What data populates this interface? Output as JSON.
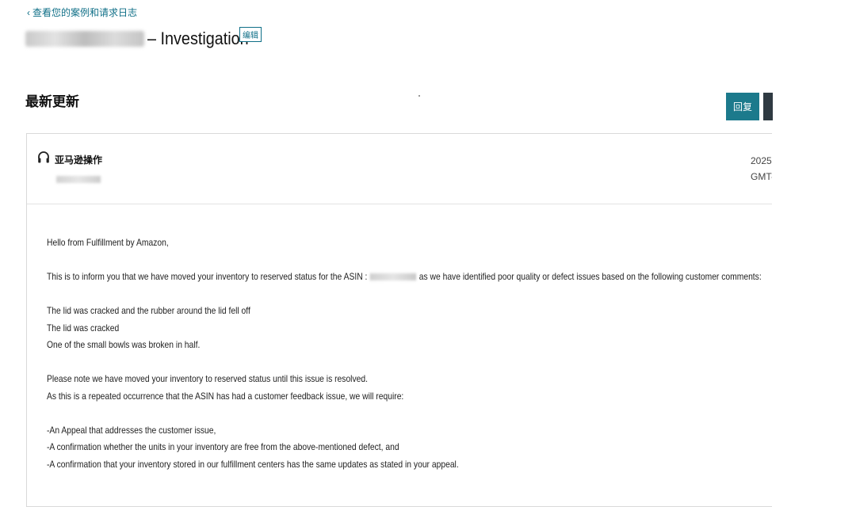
{
  "nav": {
    "back_chevron": "‹",
    "back_label": "查看您的案例和请求日志"
  },
  "header": {
    "title_suffix": "– Investigation",
    "edit_label": "编辑"
  },
  "section": {
    "title": "最新更新"
  },
  "actions": {
    "reply_label": "回复"
  },
  "message": {
    "icon": "headset-icon",
    "sender": "亚马逊操作",
    "date_line1": "2025",
    "date_line2": "GMT-",
    "greeting": "Hello from Fulfillment by Amazon,",
    "inform_prefix": "This is to inform you that we have moved your inventory to reserved status for the ASIN :",
    "inform_suffix": "as we have identified poor quality or defect issues based on the following customer comments:",
    "comment1": "The lid was cracked and the rubber around the lid fell off",
    "comment2": "The lid was cracked",
    "comment3": "One of the small bowls was broken in half.",
    "note1": "Please note we have moved your inventory to reserved status until this issue is resolved.",
    "note2": "As this is a repeated occurrence that the ASIN has had a customer feedback issue, we will require:",
    "req1": "-An Appeal that addresses the customer issue,",
    "req2": "-A confirmation whether the units in your inventory are free from the above-mentioned defect, and",
    "req3": "-A confirmation that your inventory stored in our fulfillment centers has the same updates as stated in your appeal."
  },
  "colors": {
    "accent": "#1c7a8c",
    "link": "#0f6f87",
    "dark_button": "#2f3a42"
  }
}
